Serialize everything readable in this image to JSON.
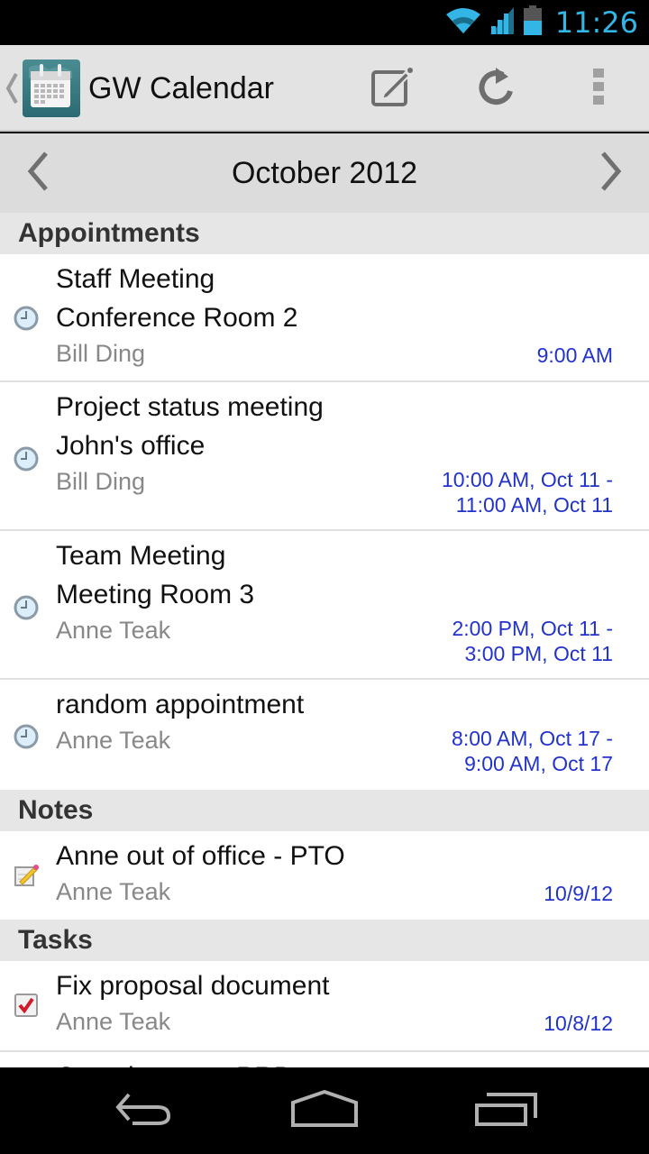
{
  "status_bar": {
    "time": "11:26",
    "icons": [
      "wifi-icon",
      "signal-icon",
      "battery-icon"
    ],
    "accent_color": "#33b5e5"
  },
  "action_bar": {
    "title": "GW Calendar",
    "app_icon": "calendar-app-icon",
    "actions": [
      {
        "name": "compose",
        "icon": "compose-icon"
      },
      {
        "name": "refresh",
        "icon": "refresh-icon"
      },
      {
        "name": "overflow",
        "icon": "overflow-menu-icon"
      }
    ]
  },
  "month_nav": {
    "title": "October 2012",
    "prev_icon": "chevron-left-icon",
    "next_icon": "chevron-right-icon"
  },
  "sections": {
    "appointments": {
      "label": "Appointments",
      "items": [
        {
          "title": "Staff Meeting",
          "location": "Conference Room 2",
          "owner": "Bill Ding",
          "time_line1": "9:00 AM",
          "time_line2": ""
        },
        {
          "title": "Project status meeting",
          "location": "John's office",
          "owner": "Bill Ding",
          "time_line1": "10:00 AM, Oct 11 -",
          "time_line2": "11:00 AM, Oct 11"
        },
        {
          "title": "Team Meeting",
          "location": "Meeting Room 3",
          "owner": "Anne Teak",
          "time_line1": "2:00 PM, Oct 11 -",
          "time_line2": "3:00 PM, Oct 11"
        },
        {
          "title": "random appointment",
          "owner": "Anne Teak",
          "time_line1": "8:00 AM, Oct 17 -",
          "time_line2": "9:00 AM, Oct 17"
        }
      ]
    },
    "notes": {
      "label": "Notes",
      "items": [
        {
          "title": "Anne out of office - PTO",
          "owner": "Anne Teak",
          "date": "10/9/12"
        }
      ]
    },
    "tasks": {
      "label": "Tasks",
      "items": [
        {
          "title": "Fix proposal document",
          "owner": "Anne Teak",
          "date": "10/8/12"
        },
        {
          "title": "Complete new PRD"
        }
      ]
    }
  },
  "colors": {
    "time_text": "#2233cc",
    "secondary_text": "#888888",
    "section_header_bg": "#e6e6e6"
  },
  "nav_bar": {
    "buttons": [
      "back-icon",
      "home-icon",
      "recents-icon"
    ]
  }
}
